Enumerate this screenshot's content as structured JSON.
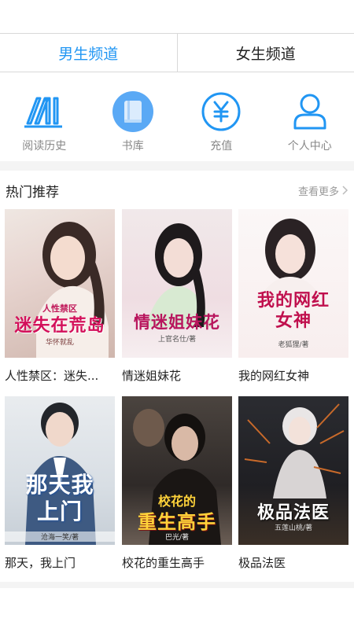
{
  "tabs": [
    {
      "label": "男生频道",
      "active": true
    },
    {
      "label": "女生频道",
      "active": false
    }
  ],
  "nav": [
    {
      "label": "阅读历史",
      "icon": "reading-history-icon"
    },
    {
      "label": "书库",
      "icon": "library-icon"
    },
    {
      "label": "充值",
      "icon": "recharge-yen-icon"
    },
    {
      "label": "个人中心",
      "icon": "user-profile-icon"
    }
  ],
  "section": {
    "title": "热门推荐",
    "more": "查看更多"
  },
  "colors": {
    "accent": "#2196f3",
    "muted": "#888888"
  },
  "books": [
    {
      "title": "人性禁区：迷失...",
      "cover_title": "迷失在荒岛",
      "cover_small": "人性禁区",
      "cover_author": "华怀就乱"
    },
    {
      "title": "情迷姐妹花",
      "cover_title": "情迷姐妹花",
      "cover_small": "",
      "cover_author": "上官名仕/著"
    },
    {
      "title": "我的网红女神",
      "cover_title": "我的网红女神",
      "cover_small": "",
      "cover_author": "老狐狸/著"
    },
    {
      "title": "那天，我上门",
      "cover_title": "那天我上门",
      "cover_small": "",
      "cover_author": "沧海一笑/著"
    },
    {
      "title": "校花的重生高手",
      "cover_title": "重生高手",
      "cover_small": "校花的",
      "cover_author": "巴光/著"
    },
    {
      "title": "极品法医",
      "cover_title": "极品法医",
      "cover_small": "",
      "cover_author": "五莲山桃/著"
    }
  ]
}
